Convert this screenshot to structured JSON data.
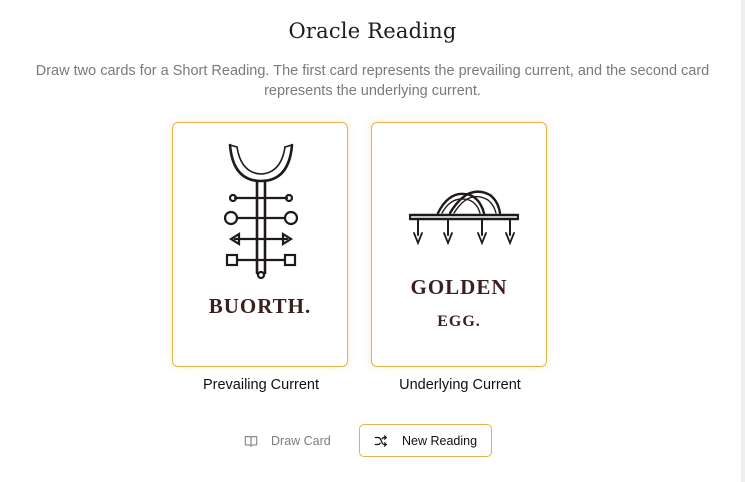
{
  "page": {
    "title": "Oracle Reading",
    "description": "Draw two cards for a Short Reading. The first card represents the prevailing current, and the second card represents the underlying current."
  },
  "cards": [
    {
      "name_lines": [
        "BUORTH."
      ],
      "caption": "Prevailing Current",
      "sigil_icon": "buorth-sigil-icon"
    },
    {
      "name_lines": [
        "GOLDEN",
        "EGG."
      ],
      "caption": "Underlying Current",
      "sigil_icon": "golden-egg-sigil-icon"
    }
  ],
  "actions": {
    "draw_card": {
      "label": "Draw Card",
      "icon": "book-icon",
      "enabled": false
    },
    "new_reading": {
      "label": "New Reading",
      "icon": "shuffle-icon",
      "enabled": true
    }
  },
  "colors": {
    "accent_border": "#e3b44a",
    "card_text": "#3a1f1f",
    "muted_text": "#7a7a7a"
  }
}
